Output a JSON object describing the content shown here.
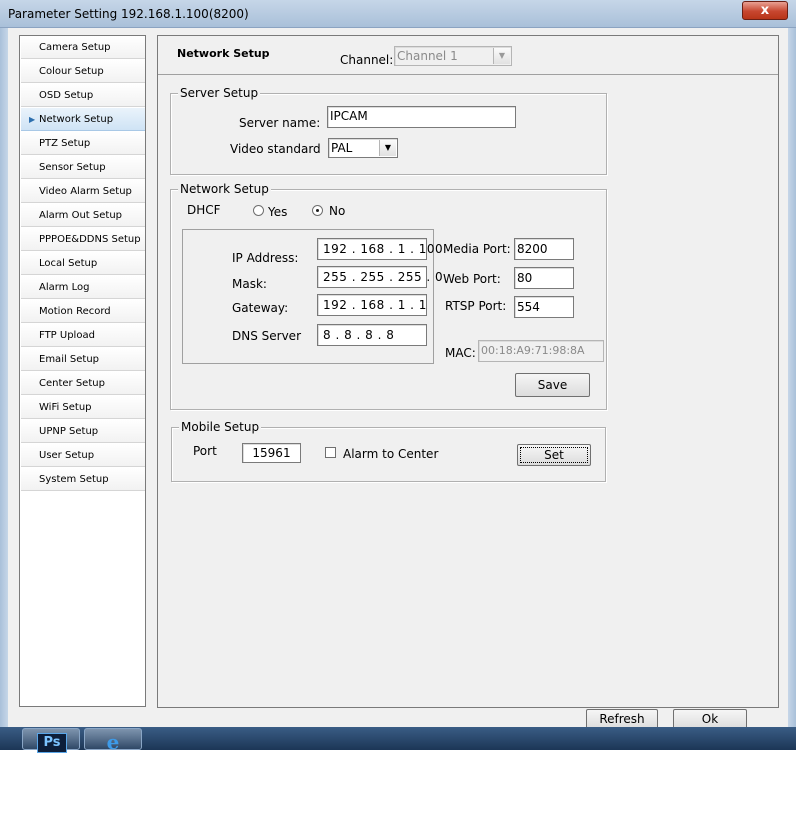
{
  "window": {
    "title": "Parameter Setting 192.168.1.100(8200)",
    "close_glyph": "x"
  },
  "sidebar": {
    "items": [
      {
        "label": "Camera Setup"
      },
      {
        "label": "Colour Setup"
      },
      {
        "label": "OSD Setup"
      },
      {
        "label": "Network Setup",
        "active": true
      },
      {
        "label": "PTZ Setup"
      },
      {
        "label": "Sensor Setup"
      },
      {
        "label": "Video Alarm Setup"
      },
      {
        "label": "Alarm Out Setup"
      },
      {
        "label": "PPPOE&DDNS Setup"
      },
      {
        "label": "Local Setup"
      },
      {
        "label": "Alarm Log"
      },
      {
        "label": "Motion Record"
      },
      {
        "label": "FTP Upload"
      },
      {
        "label": "Email Setup"
      },
      {
        "label": "Center Setup"
      },
      {
        "label": "WiFi Setup"
      },
      {
        "label": "UPNP Setup"
      },
      {
        "label": "User Setup"
      },
      {
        "label": "System Setup"
      }
    ]
  },
  "header": {
    "title": "Network Setup",
    "channel_label": "Channel:",
    "channel_value": "Channel 1"
  },
  "server_setup": {
    "title": "Server Setup",
    "server_name_label": "Server name:",
    "server_name_value": "IPCAM",
    "video_standard_label": "Video standard",
    "video_standard_value": "PAL"
  },
  "network_setup": {
    "title": "Network Setup",
    "dhcp_label": "DHCF",
    "dhcp_yes": "Yes",
    "dhcp_no": "No",
    "dhcp_selected": "No",
    "ip_label": "IP Address:",
    "ip_value": "192 . 168 .  1  . 100",
    "mask_label": "Mask:",
    "mask_value": "255 . 255 . 255 .  0",
    "gateway_label": "Gateway:",
    "gateway_value": "192 . 168 .  1  .  1",
    "dns_label": "DNS Server",
    "dns_value": " 8  .  8  .  8  .  8",
    "media_port_label": "Media Port:",
    "media_port_value": "8200",
    "web_port_label": "Web Port:",
    "web_port_value": "80",
    "rtsp_port_label": "RTSP Port:",
    "rtsp_port_value": "554",
    "mac_label": "MAC:",
    "mac_value": "00:18:A9:71:98:8A",
    "save_label": "Save"
  },
  "mobile_setup": {
    "title": "Mobile Setup",
    "port_label": "Port",
    "port_value": "15961",
    "alarm_center_label": "Alarm to Center",
    "alarm_center_checked": false,
    "set_label": "Set"
  },
  "footer": {
    "refresh_label": "Refresh",
    "ok_label": "Ok"
  },
  "taskbar": {
    "ps_label": "Ps",
    "ie_label": "e"
  }
}
